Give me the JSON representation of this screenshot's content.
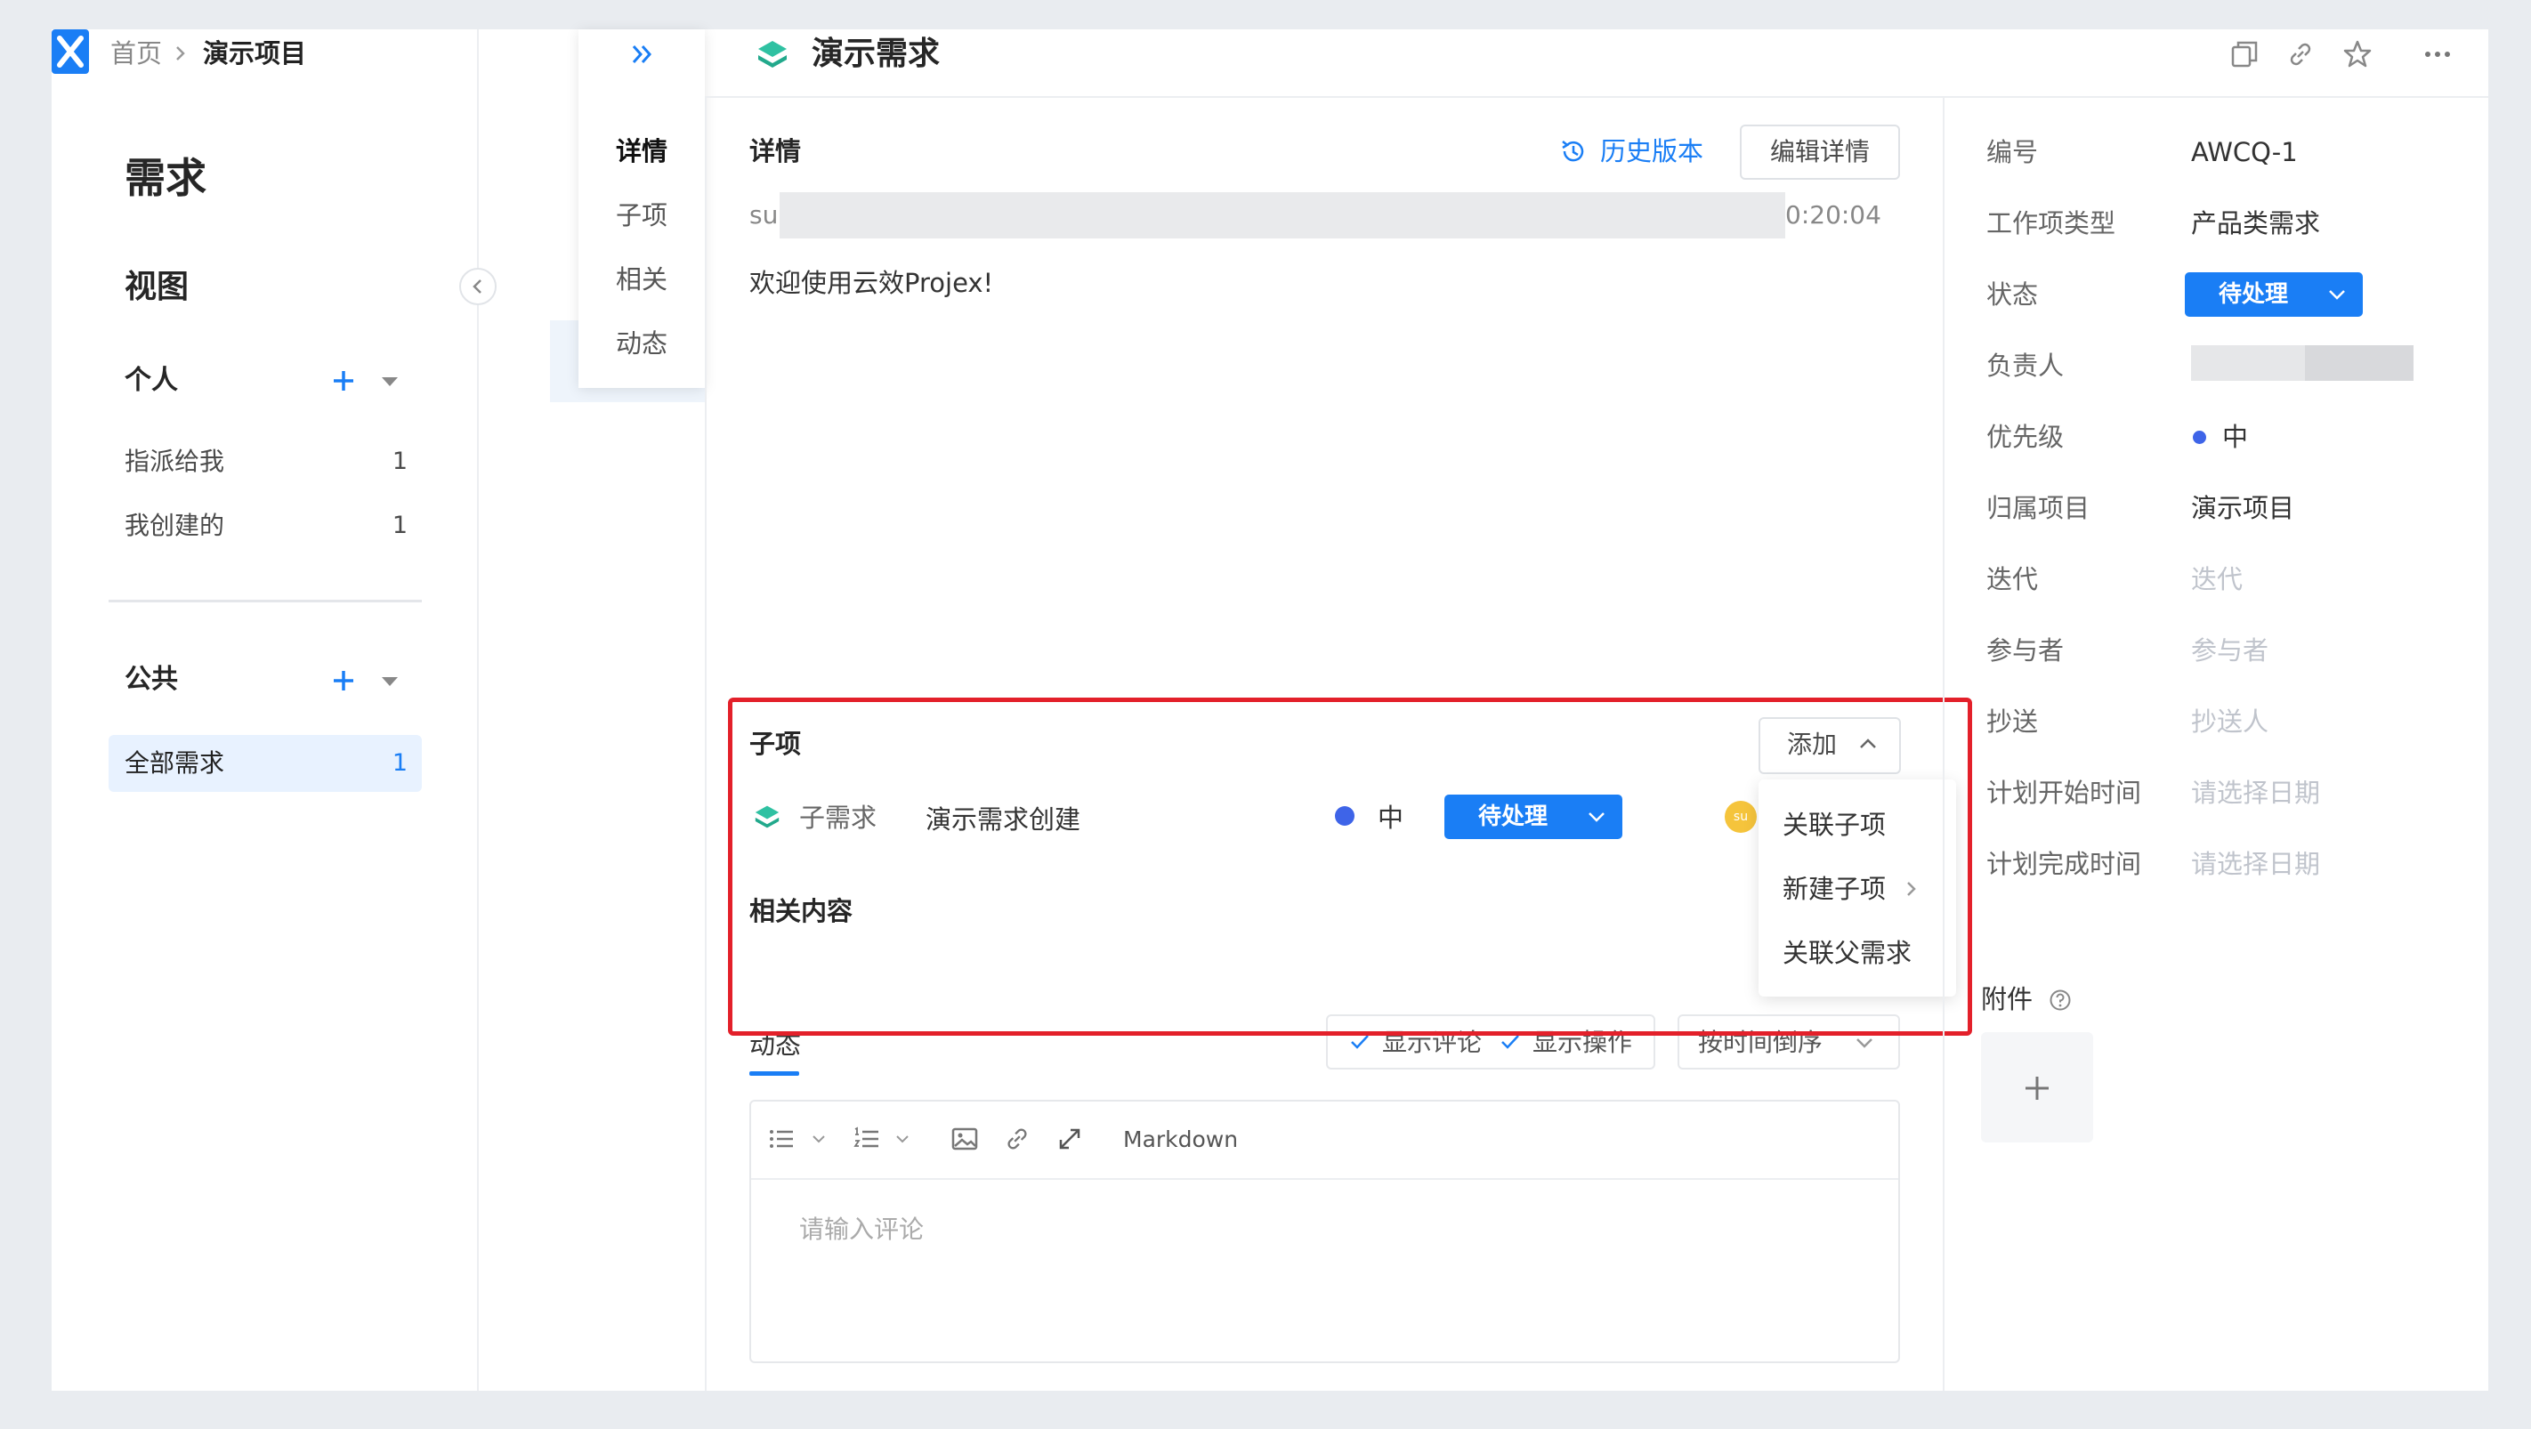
{
  "breadcrumb": {
    "home": "首页",
    "project": "演示项目"
  },
  "sidebar": {
    "title": "需求",
    "views_title": "视图",
    "personal": {
      "label": "个人",
      "items": [
        {
          "label": "指派给我",
          "count": "1"
        },
        {
          "label": "我创建的",
          "count": "1"
        }
      ]
    },
    "public": {
      "label": "公共",
      "items": [
        {
          "label": "全部需求",
          "count": "1"
        }
      ]
    }
  },
  "tab_rail": {
    "tabs": [
      "详情",
      "子项",
      "相关",
      "动态"
    ],
    "active": "详情"
  },
  "header": {
    "title": "演示需求"
  },
  "detail": {
    "section_title": "详情",
    "history_label": "历史版本",
    "edit_label": "编辑详情",
    "meta_prefix": "su",
    "meta_time": "0:20:04",
    "description": "欢迎使用云效Projex!"
  },
  "subitems": {
    "title": "子项",
    "add_label": "添加",
    "rows": [
      {
        "type": "子需求",
        "name": "演示需求创建",
        "priority": "中",
        "status": "待处理",
        "avatar": "su"
      }
    ],
    "dropdown": [
      "关联子项",
      "新建子项",
      "关联父需求"
    ]
  },
  "related": {
    "title": "相关内容"
  },
  "activity": {
    "tab_label": "动态",
    "show_comments": "显示评论",
    "show_operations": "显示操作",
    "sort_label": "按时间倒序",
    "editor_mode": "Markdown",
    "editor_placeholder": "请输入评论"
  },
  "properties": {
    "fields": [
      {
        "label": "编号",
        "value": "AWCQ-1"
      },
      {
        "label": "工作项类型",
        "value": "产品类需求"
      },
      {
        "label": "状态",
        "value": "待处理"
      },
      {
        "label": "负责人",
        "value": ""
      },
      {
        "label": "优先级",
        "value": "中"
      },
      {
        "label": "归属项目",
        "value": "演示项目"
      },
      {
        "label": "迭代",
        "value": "迭代"
      },
      {
        "label": "参与者",
        "value": "参与者"
      },
      {
        "label": "抄送",
        "value": "抄送人"
      },
      {
        "label": "计划开始时间",
        "value": "请选择日期"
      },
      {
        "label": "计划完成时间",
        "value": "请选择日期"
      }
    ],
    "attachments_label": "附件"
  },
  "colors": {
    "accent": "#1a7ef5",
    "highlight": "#e3202a",
    "priority_medium": "#3e64e8",
    "avatar": "#f5c43c"
  }
}
